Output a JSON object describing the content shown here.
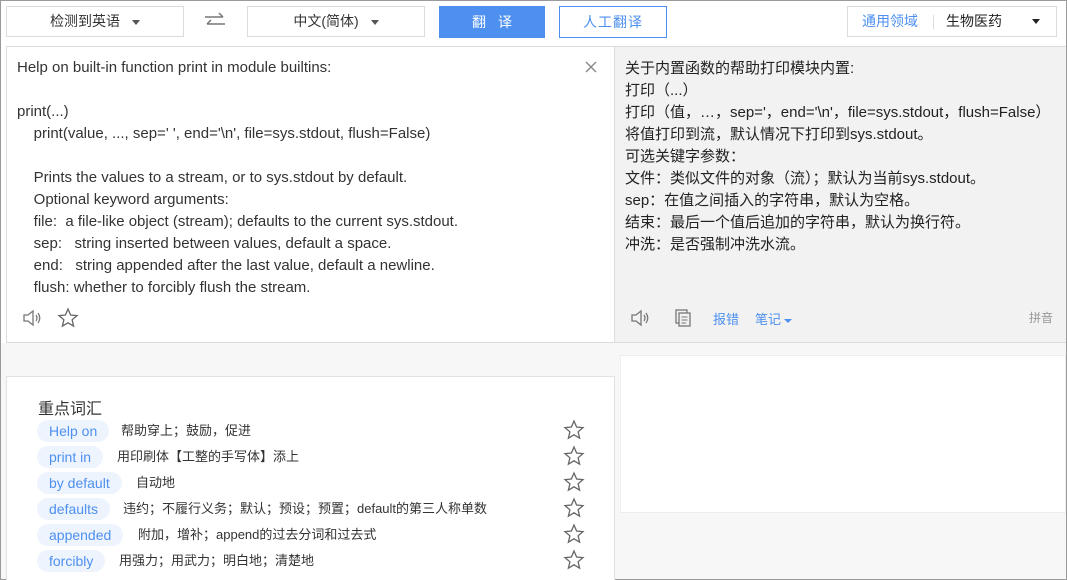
{
  "topbar": {
    "source_lang": "检测到英语",
    "target_lang": "中文(简体)",
    "translate_button": "翻译",
    "human_translate_button": "人工翻译",
    "domain_label": "通用领域",
    "domain_value": "生物医药"
  },
  "source": {
    "text": "Help on built-in function print in module builtins:\n\nprint(...)\n    print(value, ..., sep=' ', end='\\n', file=sys.stdout, flush=False)\n\n    Prints the values to a stream, or to sys.stdout by default.\n    Optional keyword arguments:\n    file:  a file-like object (stream); defaults to the current sys.stdout.\n    sep:   string inserted between values, default a space.\n    end:   string appended after the last value, default a newline.\n    flush: whether to forcibly flush the stream."
  },
  "target": {
    "text": "关于内置函数的帮助打印模块内置:\n打印（...）\n打印（值，…，sep='，end='\\n'，file=sys.stdout，flush=False）\n将值打印到流，默认情况下打印到sys.stdout。\n可选关键字参数：\n文件：类似文件的对象（流）；默认为当前sys.stdout。\nsep：在值之间插入的字符串，默认为空格。\n结束：最后一个值后追加的字符串，默认为换行符。\n冲洗：是否强制冲洗水流。",
    "report_link": "报错",
    "notes_link": "笔记",
    "pinyin_label": "拼音"
  },
  "vocab": {
    "title": "重点词汇",
    "items": [
      {
        "term": "Help on",
        "definition": "帮助穿上；鼓励，促进"
      },
      {
        "term": "print in",
        "definition": "用印刷体【工整的手写体】添上"
      },
      {
        "term": "by default",
        "definition": "自动地"
      },
      {
        "term": "defaults",
        "definition": "违约；不履行义务；默认；预设；预置；default的第三人称单数"
      },
      {
        "term": "appended",
        "definition": "附加，增补；append的过去分词和过去式"
      },
      {
        "term": "forcibly",
        "definition": "用强力；用武力；明白地；清楚地"
      }
    ]
  },
  "colors": {
    "accent": "#4d90f0",
    "term_bg": "#eef4fd",
    "right_panel_bg": "#f2f2f2"
  },
  "icons": {
    "swap": "swap-arrows-icon",
    "close": "close-icon",
    "speaker": "speaker-icon",
    "star": "star-outline-icon",
    "copy": "copy-icon",
    "dropdown": "caret-down-icon"
  }
}
